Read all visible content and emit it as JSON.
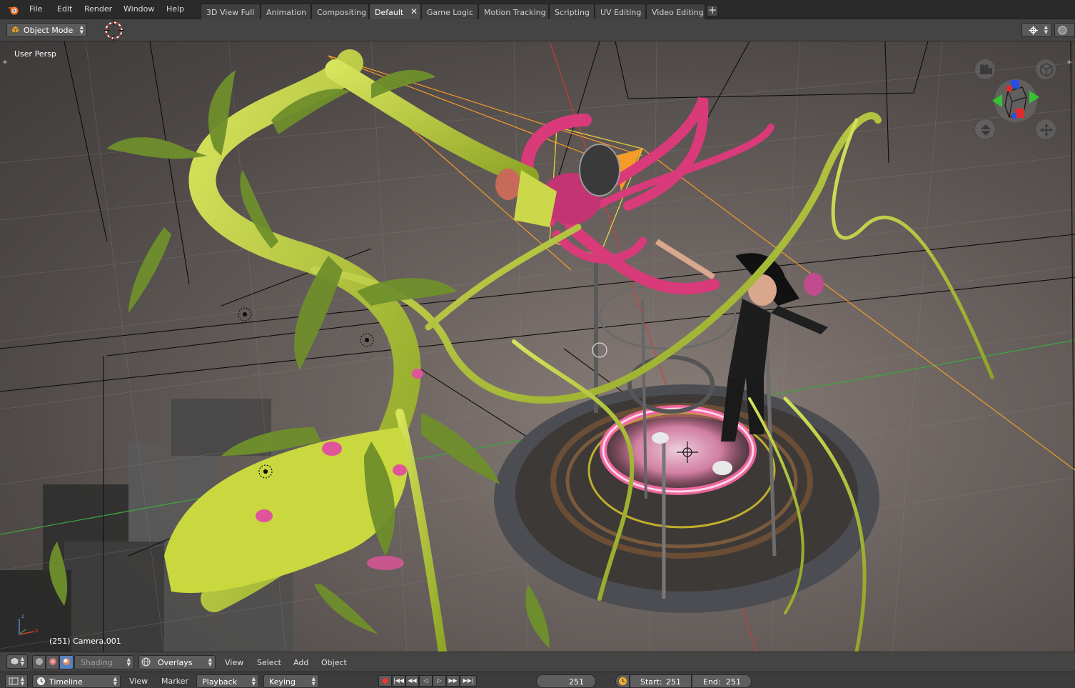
{
  "menu": {
    "items": [
      "File",
      "Edit",
      "Render",
      "Window",
      "Help"
    ]
  },
  "workspaces": {
    "tabs": [
      "3D View Full",
      "Animation",
      "Compositing",
      "Default",
      "Game Logic",
      "Motion Tracking",
      "Scripting",
      "UV Editing",
      "Video Editing"
    ],
    "active": "Default",
    "close_glyph": "✕",
    "add_glyph": "+"
  },
  "viewport_header": {
    "mode_label": "Object Mode"
  },
  "viewport": {
    "view_label": "User Persp",
    "object_label": "(251) Camera.001",
    "axis_z": "z",
    "axis_x": "x"
  },
  "viewport_footer": {
    "shading_label": "Shading",
    "overlays_label": "Overlays",
    "menus": [
      "View",
      "Select",
      "Add",
      "Object"
    ]
  },
  "timeline": {
    "editor_label": "Timeline",
    "menus": [
      "View",
      "Marker"
    ],
    "playback_label": "Playback",
    "keying_label": "Keying",
    "current_frame": "251",
    "start_label": "Start:",
    "start_value": "251",
    "end_label": "End:",
    "end_value": "251"
  },
  "colors": {
    "accent_active_tab": "#4d4d4d",
    "plant_green": "#b8cc3a",
    "flower_pink": "#d93a7a",
    "ring_glow": "#ff6aa8",
    "axis_red": "#d23b3b",
    "axis_green": "#3fa33f"
  },
  "icons": [
    "blender-logo-icon",
    "cube-icon",
    "cursor-icon",
    "pivot-icon",
    "camera-view-icon",
    "ortho-view-icon",
    "zoom-icon",
    "pan-icon",
    "viewport-type-icon",
    "shading-solid-icon",
    "shading-material-icon",
    "shading-render-icon",
    "globe-icon",
    "clock-icon",
    "record-icon",
    "jump-start-icon",
    "prev-key-icon",
    "play-reverse-icon",
    "play-icon",
    "next-key-icon",
    "jump-end-icon"
  ]
}
